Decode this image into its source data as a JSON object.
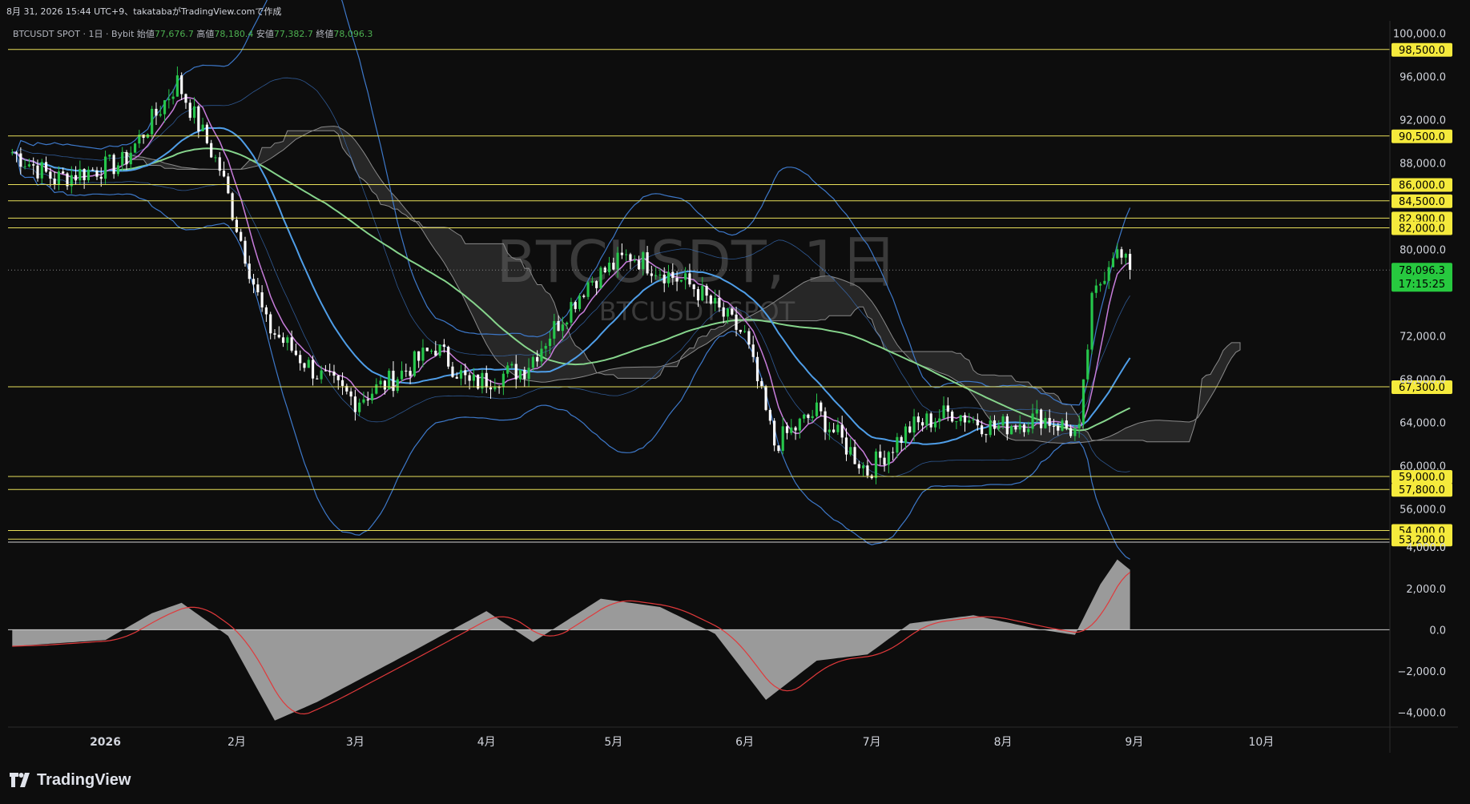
{
  "header": {
    "text": "8月 31, 2026 15:44 UTC+9、takatabaがTradingView.comで作成"
  },
  "symbol": {
    "name": "BTCUSDT SPOT · 1日 · Bybit",
    "open_label": "始値",
    "open": "77,676.7",
    "high_label": "高値",
    "high": "78,180.4",
    "low_label": "安値",
    "low": "77,382.7",
    "close_label": "終値",
    "close": "78,096.3"
  },
  "watermark": {
    "line1": "BTCUSDT, 1日",
    "line2": "BTCUSDT SPOT"
  },
  "brand": {
    "name": "TradingView"
  },
  "colors": {
    "background": "#0d0d0d",
    "up": "#26c64b",
    "down": "#ffffff",
    "hline": "#e8df5a",
    "label_bg": "#f5ea3c",
    "price_bg": "#27c93f",
    "sma_fast": "#c77ddb",
    "sma_mid": "#4f9ee8",
    "sma_slow": "#86d48c",
    "bollinger": "#3d78c9",
    "cloud": "#6d6d6d",
    "macd_hist": "#9a9a9a",
    "signal": "#e0393b"
  },
  "chart_data": [
    {
      "type": "candlestick",
      "title": "BTCUSDT SPOT · 1日 · Bybit",
      "x_tick_labels": [
        "2026",
        "2月",
        "3月",
        "4月",
        "5月",
        "6月",
        "7月",
        "8月",
        "9月",
        "10月"
      ],
      "y_tick_labels": [
        "100,000.0",
        "96,000.0",
        "92,000.0",
        "88,000.0",
        "80,000.0",
        "72,000.0",
        "68,000.0",
        "64,000.0",
        "60,000.0",
        "56,000.0"
      ],
      "ylim": [
        53000,
        101000
      ],
      "horizontal_levels": [
        98500,
        90500,
        86000,
        84500,
        82900,
        82000,
        67300,
        59000,
        57800,
        54000,
        53200
      ],
      "horizontal_level_labels": [
        "98,500.0",
        "90,500.0",
        "86,000.0",
        "84,500.0",
        "82,900.0",
        "82,000.0",
        "67,300.0",
        "59,000.0",
        "57,800.0",
        "54,000.0",
        "53,200.0"
      ],
      "last_price": 78096.3,
      "last_price_label": "78,096.3",
      "countdown": "17:15:25",
      "price_path": [
        [
          "2025-12-10",
          89000
        ],
        [
          "2025-12-20",
          86500
        ],
        [
          "2026-01-05",
          88000
        ],
        [
          "2026-01-13",
          92500
        ],
        [
          "2026-01-18",
          95500
        ],
        [
          "2026-01-28",
          87500
        ],
        [
          "2026-02-08",
          73000
        ],
        [
          "2026-02-20",
          68500
        ],
        [
          "2026-03-01",
          66000
        ],
        [
          "2026-03-10",
          68000
        ],
        [
          "2026-03-20",
          71000
        ],
        [
          "2026-03-28",
          67500
        ],
        [
          "2026-04-10",
          69000
        ],
        [
          "2026-04-25",
          77000
        ],
        [
          "2026-05-05",
          79500
        ],
        [
          "2026-05-20",
          76500
        ],
        [
          "2026-06-01",
          72000
        ],
        [
          "2026-06-08",
          62000
        ],
        [
          "2026-06-18",
          65000
        ],
        [
          "2026-06-30",
          59500
        ],
        [
          "2026-07-10",
          63500
        ],
        [
          "2026-07-20",
          65000
        ],
        [
          "2026-07-30",
          63500
        ],
        [
          "2026-08-10",
          64500
        ],
        [
          "2026-08-19",
          63000
        ],
        [
          "2026-08-22",
          75000
        ],
        [
          "2026-08-27",
          80000
        ],
        [
          "2026-08-31",
          78096
        ]
      ]
    },
    {
      "type": "area",
      "title": "MACD",
      "y_tick_labels": [
        "4,000.0",
        "2,000.0",
        "0.0",
        "−2,000.0",
        "−4,000.0"
      ],
      "ylim": [
        -4600,
        4200
      ],
      "histogram": [
        [
          "2025-12-10",
          -800
        ],
        [
          "2026-01-01",
          -500
        ],
        [
          "2026-01-12",
          800
        ],
        [
          "2026-01-19",
          1300
        ],
        [
          "2026-01-30",
          -300
        ],
        [
          "2026-02-10",
          -4400
        ],
        [
          "2026-02-20",
          -3500
        ],
        [
          "2026-03-15",
          -1000
        ],
        [
          "2026-04-01",
          900
        ],
        [
          "2026-04-12",
          -600
        ],
        [
          "2026-04-28",
          1500
        ],
        [
          "2026-05-12",
          1100
        ],
        [
          "2026-05-25",
          -200
        ],
        [
          "2026-06-06",
          -3400
        ],
        [
          "2026-06-18",
          -1500
        ],
        [
          "2026-06-30",
          -1200
        ],
        [
          "2026-07-10",
          300
        ],
        [
          "2026-07-25",
          700
        ],
        [
          "2026-08-10",
          0
        ],
        [
          "2026-08-18",
          -250
        ],
        [
          "2026-08-24",
          2200
        ],
        [
          "2026-08-28",
          3400
        ],
        [
          "2026-08-31",
          2900
        ]
      ]
    }
  ]
}
